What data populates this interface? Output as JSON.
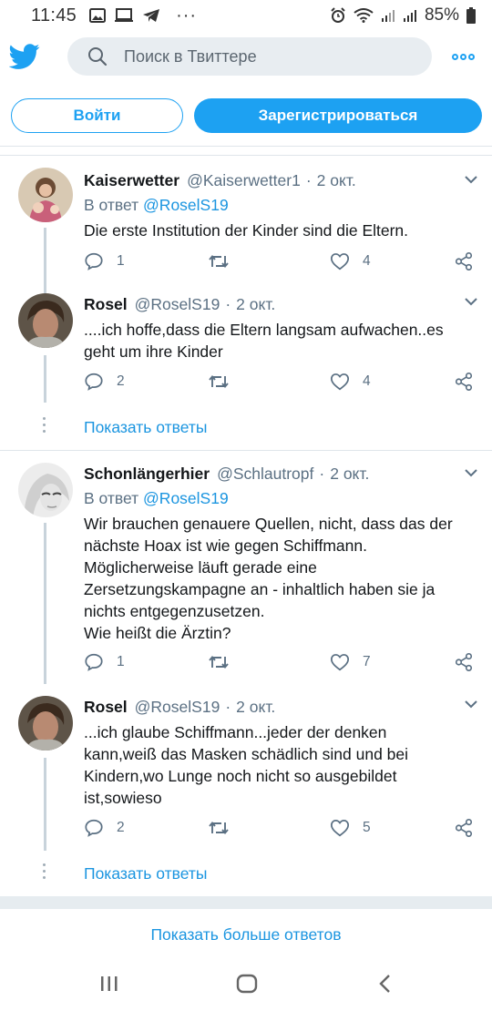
{
  "status_bar": {
    "time": "11:45",
    "dots": "···",
    "battery": "85%"
  },
  "search": {
    "placeholder": "Поиск в Твиттере"
  },
  "auth": {
    "login": "Войти",
    "signup": "Зарегистрироваться"
  },
  "tweets": [
    {
      "name": "Kaiserwetter",
      "handle": "@Kaiserwetter1",
      "sep": "·",
      "date": "2 окт.",
      "reply_prefix": "В ответ",
      "reply_to": "@RoselS19",
      "text": "Die erste Institution der Kinder sind die Eltern.",
      "replies": "1",
      "retweets": "",
      "likes": "4"
    },
    {
      "name": "Rosel",
      "handle": "@RoselS19",
      "sep": "·",
      "date": "2 окт.",
      "text": "....ich hoffe,dass die Eltern langsam aufwachen..es\ngeht um ihre Kinder",
      "replies": "2",
      "retweets": "",
      "likes": "4"
    },
    {
      "name": "Schonlängerhier",
      "handle": "@Schlautropf",
      "sep": "·",
      "date": "2 окт.",
      "reply_prefix": "В ответ",
      "reply_to": "@RoselS19",
      "text": "Wir brauchen genauere Quellen, nicht, dass das der\nnächste Hoax ist wie gegen Schiffmann.\nMöglicherweise läuft gerade eine\nZersetzungskampagne an - inhaltlich haben sie ja\nnichts entgegenzusetzen.\nWie heißt die Ärztin?",
      "replies": "1",
      "retweets": "",
      "likes": "7"
    },
    {
      "name": "Rosel",
      "handle": "@RoselS19",
      "sep": "·",
      "date": "2 окт.",
      "text": "...ich glaube Schiffmann...jeder der denken\nkann,weiß das Masken schädlich sind und bei\nKindern,wo Lunge noch nicht so ausgebildet\nist,sowieso",
      "replies": "2",
      "retweets": "",
      "likes": "5"
    }
  ],
  "show_replies": "Показать ответы",
  "show_more_replies": "Показать больше ответов",
  "colors": {
    "accent": "#1da1f2",
    "link": "#1b95e0",
    "secondary_text": "#5b7083",
    "band": "#e6ecf0"
  }
}
